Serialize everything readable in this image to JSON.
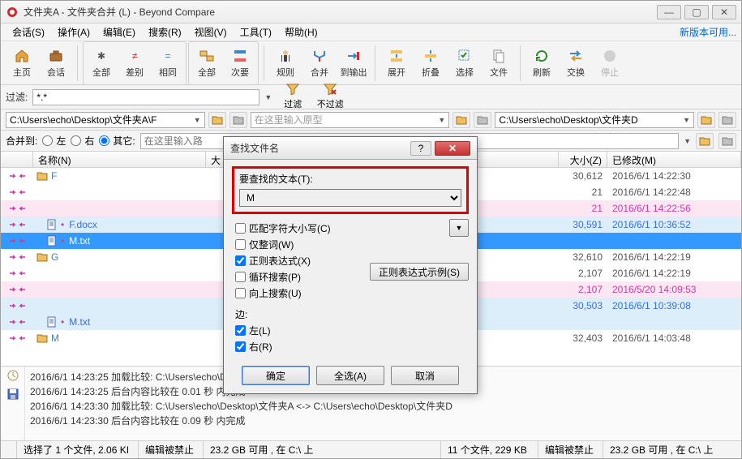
{
  "window": {
    "title": "文件夹A - 文件夹合并 (L) - Beyond Compare",
    "min": "—",
    "max": "▢",
    "close": "✕"
  },
  "menu": {
    "items": [
      "会话(S)",
      "操作(A)",
      "编辑(E)",
      "搜索(R)",
      "视图(V)",
      "工具(T)",
      "帮助(H)"
    ],
    "newver": "新版本可用..."
  },
  "toolbar": {
    "home": "主页",
    "session": "会话",
    "all": "全部",
    "diff": "差别",
    "same": "相同",
    "all2": "全部",
    "minor": "次要",
    "rules": "规则",
    "merge": "合并",
    "tooutput": "到输出",
    "expand": "展开",
    "collapse": "折叠",
    "select": "选择",
    "files": "文件",
    "refresh": "刷新",
    "swap": "交换",
    "stop": "停止"
  },
  "filter": {
    "label": "过滤:",
    "value": "*.*",
    "btnfilter": "过滤",
    "btnnofilter": "不过滤"
  },
  "paths": {
    "left": "C:\\Users\\echo\\Desktop\\文件夹A\\F",
    "center_ph": "在这里输入原型",
    "right": "C:\\Users\\echo\\Desktop\\文件夹D"
  },
  "merge": {
    "label": "合并到:",
    "left": "左",
    "right": "右",
    "other": "其它:",
    "input_ph": "在这里输入路"
  },
  "cols": {
    "name": "名称(N)",
    "size_l": "大",
    "size_r": "大小(Z)",
    "mod_r": "已修改(M)"
  },
  "rows": [
    {
      "type": "folder",
      "name": "F",
      "size": "30,612",
      "mod": "2016/6/1 14:22:30"
    },
    {
      "type": "row",
      "name": "",
      "size": "21",
      "mod": "2016/6/1 14:22:48"
    },
    {
      "type": "pink",
      "name": "",
      "size": "21",
      "mod": "2016/6/1 14:22:56"
    },
    {
      "type": "blue",
      "name": "F.docx",
      "size": "30,591",
      "mod": "2016/6/1 10:36:52"
    },
    {
      "type": "sel",
      "name": "M.txt",
      "size": "",
      "mod": ""
    },
    {
      "type": "folder",
      "name": "G",
      "size": "32,610",
      "mod": "2016/6/1 14:22:19"
    },
    {
      "type": "row",
      "name": "",
      "size": "2,107",
      "mod": "2016/6/1 14:22:19"
    },
    {
      "type": "pink",
      "name": "",
      "size": "2,107",
      "mod": "2016/5/20 14:09:53"
    },
    {
      "type": "blue",
      "name": "",
      "size": "30,503",
      "mod": "2016/6/1 10:39:08"
    },
    {
      "type": "blue",
      "name": "M.txt",
      "size": "",
      "mod": ""
    },
    {
      "type": "folder",
      "name": "M",
      "size": "32,403",
      "mod": "2016/6/1 14:03:48"
    }
  ],
  "log": [
    "2016/6/1 14:23:25  加载比较: C:\\Users\\echo\\Desktop\\文件夹A <->",
    "2016/6/1 14:23:25  后台内容比较在 0.01 秒 内完成",
    "2016/6/1 14:23:30  加载比较: C:\\Users\\echo\\Desktop\\文件夹A <-> C:\\Users\\echo\\Desktop\\文件夹D",
    "2016/6/1 14:23:30  后台内容比较在 0.09 秒 内完成"
  ],
  "status": {
    "c1": "选择了 1 个文件, 2.06 KI",
    "c2": "编辑被禁止",
    "c3": "23.2 GB 可用 , 在 C:\\ 上",
    "c4": "11 个文件, 229 KB",
    "c5": "编辑被禁止",
    "c6": "23.2 GB 可用 , 在 C:\\ 上"
  },
  "dialog": {
    "title": "查找文件名",
    "search_label": "要查找的文本(T):",
    "search_value": "M",
    "opt_matchcase": "匹配字符大小写(C)",
    "opt_wholeword": "仅整词(W)",
    "opt_regex": "正则表达式(X)",
    "opt_loop": "循环搜索(P)",
    "opt_up": "向上搜索(U)",
    "regex_examples": "正则表达式示例(S)",
    "sides": "边:",
    "side_left": "左(L)",
    "side_right": "右(R)",
    "ok": "确定",
    "selectall": "全选(A)",
    "cancel": "取消",
    "help": "?",
    "close": "✕"
  }
}
